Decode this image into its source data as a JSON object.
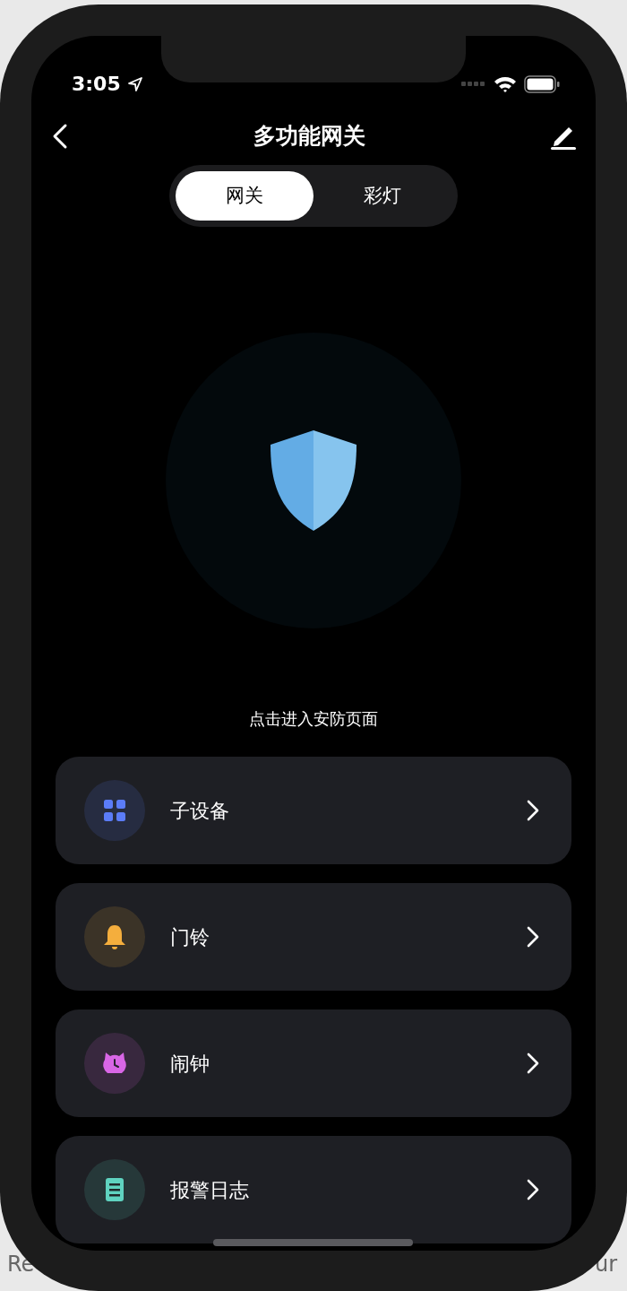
{
  "background_page": {
    "texts": [
      "Re",
      "ur"
    ]
  },
  "status_bar": {
    "time": "3:05"
  },
  "header": {
    "title": "多功能网关"
  },
  "tabs": [
    {
      "label": "网关",
      "selected": true
    },
    {
      "label": "彩灯",
      "selected": false
    }
  ],
  "security": {
    "caption": "点击进入安防页面"
  },
  "menu": [
    {
      "label": "子设备",
      "color": "#5b7cf8"
    },
    {
      "label": "门铃",
      "color": "#f4ae3d"
    },
    {
      "label": "闹钟",
      "color": "#d966e6"
    },
    {
      "label": "报警日志",
      "color": "#5fd3c0"
    }
  ]
}
